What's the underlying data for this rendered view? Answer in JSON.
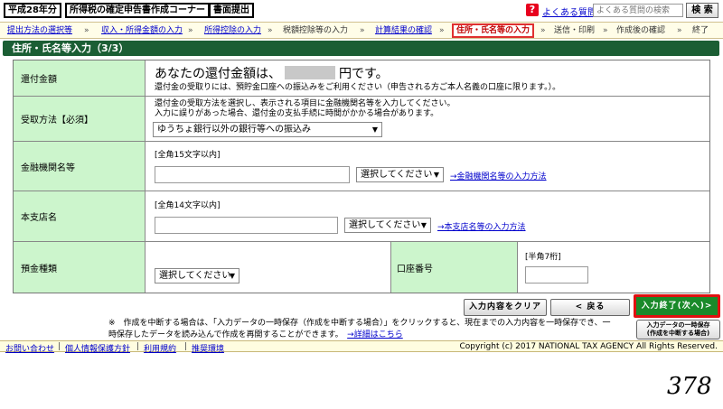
{
  "header": {
    "year_label": "平成28年分",
    "corner_label": "所得税の確定申告書作成コーナー",
    "mode_label": "書面提出",
    "help_icon_char": "?",
    "faq_label": "よくある質問",
    "search_placeholder": "よくある質問の検索",
    "search_button": "検 索"
  },
  "steps": [
    {
      "label": "提出方法の選択等",
      "state": "link"
    },
    {
      "label": "収入・所得金額の入力",
      "state": "link"
    },
    {
      "label": "所得控除の入力",
      "state": "link"
    },
    {
      "label": "税額控除等の入力",
      "state": "plain"
    },
    {
      "label": "計算結果の確認",
      "state": "link"
    },
    {
      "label": "住所・氏名等の入力",
      "state": "current"
    },
    {
      "label": "送信・印刷",
      "state": "plain"
    },
    {
      "label": "作成後の確認",
      "state": "plain"
    },
    {
      "label": "終了",
      "state": "plain"
    }
  ],
  "step_separator": "»",
  "section_title": "住所・氏名等入力（3/3）",
  "form": {
    "refund": {
      "label": "還付金額",
      "text_before": "あなたの還付金額は、",
      "text_after": "円です。",
      "note": "還付金の受取りには、預貯金口座への振込みをご利用ください（申告される方ご本人名義の口座に限ります。）。"
    },
    "method": {
      "label": "受取方法【必須】",
      "note1": "還付金の受取方法を選択し、表示される項目に金融機関名等を入力してください。",
      "note2": "入力に誤りがあった場合、還付金の支払手続に時間がかかる場合があります。",
      "selected": "ゆうちょ銀行以外の銀行等への振込み"
    },
    "bank": {
      "label": "金融機関名等",
      "hint": "[全角15文字以内]",
      "select": "選択してください",
      "link": "→金融機関名等の入力方法"
    },
    "branch": {
      "label": "本支店名",
      "hint": "[全角14文字以内]",
      "select": "選択してください",
      "link": "→本支店名等の入力方法"
    },
    "deposit": {
      "label": "預金種類",
      "select": "選択してください",
      "account_label": "口座番号",
      "account_hint": "[半角7桁]"
    }
  },
  "buttons": {
    "clear": "入力内容をクリア",
    "back": "< 戻る",
    "next": "入力終了(次へ)>",
    "temp_save_line1": "入力データの一時保存",
    "temp_save_line2": "(作成を中断する場合)"
  },
  "note": {
    "line1": "※　作成を中断する場合は、「入力データの一時保存（作成を中断する場合）」をクリックすると、現在までの入力内容を一時保存でき、一",
    "line2": "時保存したデータを読み込んで作成を再開することができます。",
    "link": "→詳細はこちら"
  },
  "footer": {
    "links": [
      "お問い合わせ",
      "個人情報保護方針",
      "利用規約",
      "推奨環境"
    ],
    "copyright": "Copyright (c) 2017 NATIONAL TAX AGENCY All Rights Reserved."
  },
  "page_number": "378",
  "colors": {
    "section_bg": "#1b5e34",
    "label_bg": "#ccf5cc",
    "next_button_bg": "#1a8a2a",
    "highlight_border": "#e01010"
  }
}
